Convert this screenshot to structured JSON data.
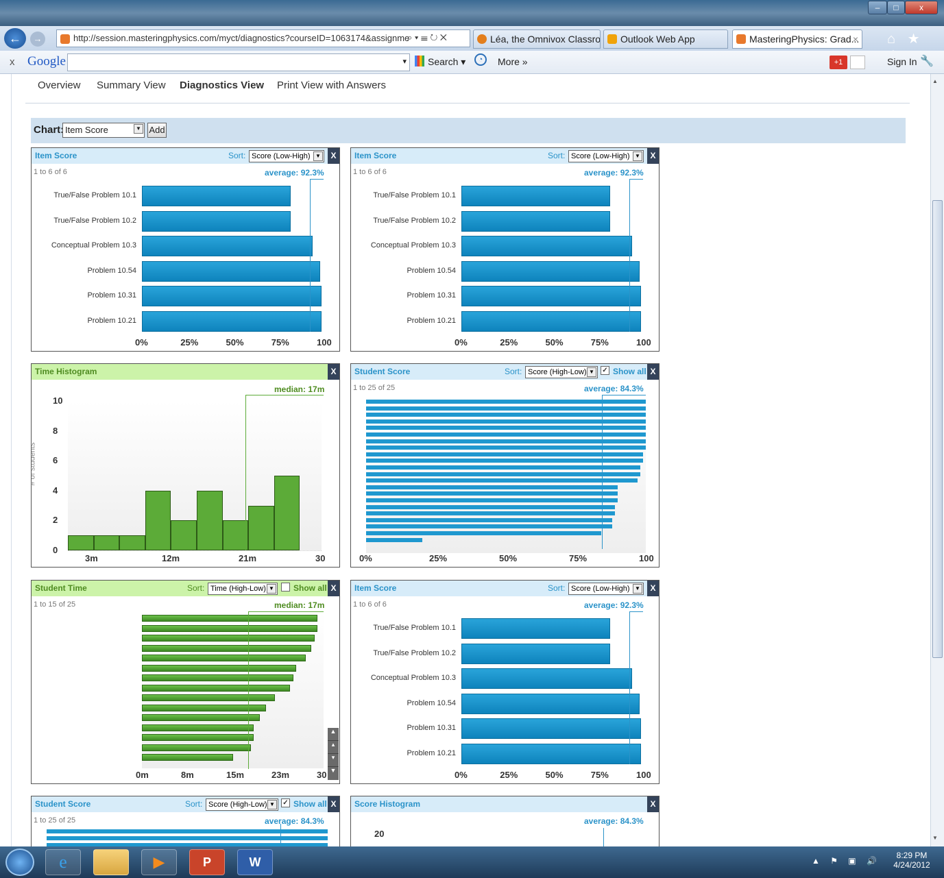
{
  "browser": {
    "url": "http://session.masteringphysics.com/myct/diagnostics?courseID=1063174&assignme",
    "address_icons": "⌕ ▾ ☰ ↻ ✕",
    "tabs": [
      {
        "label": "Léa, the Omnivox Classroo..."
      },
      {
        "label": "Outlook Web App"
      },
      {
        "label": "MasteringPhysics: Grad...",
        "close": "×"
      }
    ],
    "window_buttons": {
      "minimize": "–",
      "maximize": "□",
      "close": "x"
    },
    "home_icons": "⌂ ★ ⚙"
  },
  "google_toolbar": {
    "close": "x",
    "logo": "Google",
    "search_label": "Search ▾",
    "more_label": "More »",
    "plus_label": "+1",
    "signin_label": "Sign In",
    "dropdown": "▾"
  },
  "page": {
    "nav": [
      "Overview",
      "Summary View",
      "Diagnostics View",
      "Print View with Answers"
    ],
    "chart_label": "Chart:",
    "chart_select": "Item Score",
    "add_button": "Add"
  },
  "panels": {
    "item_score_1": {
      "title": "Item Score",
      "sort_label": "Sort:",
      "sort_value": "Score (Low-High)",
      "close": "X",
      "range": "1 to 6 of 6",
      "average": "average: 92.3%"
    },
    "item_score_2": {
      "title": "Item Score",
      "sort_label": "Sort:",
      "sort_value": "Score (Low-High)",
      "close": "X",
      "range": "1 to 6 of 6",
      "average": "average: 92.3%"
    },
    "item_score_3": {
      "title": "Item Score",
      "sort_label": "Sort:",
      "sort_value": "Score (Low-High)",
      "close": "X",
      "range": "1 to 6 of 6",
      "average": "average: 92.3%"
    },
    "time_histogram": {
      "title": "Time Histogram",
      "close": "X",
      "median": "median: 17m",
      "ylabel": "# of students"
    },
    "student_score_1": {
      "title": "Student Score",
      "sort_label": "Sort:",
      "sort_value": "Score (High-Low)",
      "show_all": "Show all",
      "close": "X",
      "range": "1 to 25 of 25",
      "average": "average: 84.3%"
    },
    "student_time": {
      "title": "Student Time",
      "sort_label": "Sort:",
      "sort_value": "Time (High-Low)",
      "show_all": "Show all",
      "close": "X",
      "range": "1 to 15 of 25",
      "median": "median: 17m"
    },
    "student_score_2": {
      "title": "Student Score",
      "sort_label": "Sort:",
      "sort_value": "Score (High-Low)",
      "show_all": "Show all",
      "close": "X",
      "range": "1 to 25 of 25",
      "average": "average: 84.3%"
    },
    "score_histogram": {
      "title": "Score Histogram",
      "close": "X",
      "average": "average: 84.3%",
      "ytick_top": "20"
    }
  },
  "chart_data": [
    {
      "type": "bar",
      "title": "Item Score",
      "categories": [
        "True/False Problem 10.1",
        "True/False Problem 10.2",
        "Conceptual Problem 10.3",
        "Problem 10.54",
        "Problem 10.31",
        "Problem 10.21"
      ],
      "values": [
        82,
        82,
        94,
        98,
        99,
        99
      ],
      "xticks": [
        "0%",
        "25%",
        "50%",
        "75%",
        "100"
      ],
      "xlim": [
        0,
        100
      ],
      "average": 92.3
    },
    {
      "type": "bar",
      "title": "Item Score",
      "categories": [
        "True/False Problem 10.1",
        "True/False Problem 10.2",
        "Conceptual Problem 10.3",
        "Problem 10.54",
        "Problem 10.31",
        "Problem 10.21"
      ],
      "values": [
        82,
        82,
        94,
        98,
        99,
        99
      ],
      "xticks": [
        "0%",
        "25%",
        "50%",
        "75%",
        "100"
      ],
      "xlim": [
        0,
        100
      ],
      "average": 92.3
    },
    {
      "type": "bar",
      "title": "Time Histogram",
      "bins": [
        1,
        1,
        1,
        4,
        2,
        4,
        2,
        3,
        5
      ],
      "ylabel": "# of students",
      "yticks": [
        "0",
        "2",
        "4",
        "6",
        "8",
        "10"
      ],
      "ylim": [
        0,
        10
      ],
      "xticks": [
        "3m",
        "12m",
        "21m",
        "30"
      ],
      "median": "17m"
    },
    {
      "type": "bar",
      "title": "Student Score",
      "values": [
        100,
        100,
        100,
        100,
        100,
        100,
        100,
        100,
        99,
        99,
        98,
        98,
        97,
        90,
        90,
        90,
        89,
        89,
        88,
        88,
        84,
        20
      ],
      "xticks": [
        "0%",
        "25%",
        "50%",
        "75%",
        "100"
      ],
      "xlim": [
        0,
        100
      ],
      "average": 84.3
    },
    {
      "type": "bar",
      "title": "Student Time",
      "values": [
        29,
        29,
        28.5,
        28,
        27,
        25.5,
        25,
        24.5,
        22,
        20.5,
        19.5,
        18.5,
        18.5,
        18,
        15
      ],
      "xticks": [
        "0m",
        "8m",
        "15m",
        "23m",
        "30"
      ],
      "xlim": [
        0,
        30
      ],
      "median": "17m"
    },
    {
      "type": "bar",
      "title": "Item Score",
      "categories": [
        "True/False Problem 10.1",
        "True/False Problem 10.2",
        "Conceptual Problem 10.3",
        "Problem 10.54",
        "Problem 10.31",
        "Problem 10.21"
      ],
      "values": [
        82,
        82,
        94,
        98,
        99,
        99
      ],
      "xticks": [
        "0%",
        "25%",
        "50%",
        "75%",
        "100"
      ],
      "xlim": [
        0,
        100
      ],
      "average": 92.3
    }
  ],
  "taskbar": {
    "time": "8:29 PM",
    "date": "4/24/2012"
  }
}
